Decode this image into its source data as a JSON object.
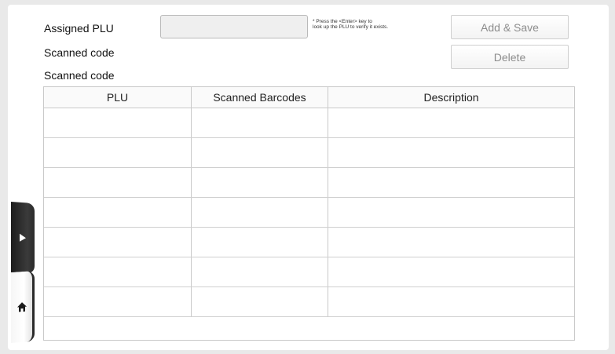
{
  "form": {
    "assigned_plu_label": "Assigned PLU",
    "assigned_plu_value": "",
    "scanned_code_label_1": "Scanned code",
    "scanned_code_label_2": "Scanned code",
    "hint_line1": "* Press the <Enter> key to",
    "hint_line2": "look up the PLU to verify it exists."
  },
  "buttons": {
    "add_save": "Add & Save",
    "delete": "Delete"
  },
  "table": {
    "headers": [
      "PLU",
      "Scanned Barcodes",
      "Description"
    ],
    "rows": [
      [
        "",
        "",
        ""
      ],
      [
        "",
        "",
        ""
      ],
      [
        "",
        "",
        ""
      ],
      [
        "",
        "",
        ""
      ],
      [
        "",
        "",
        ""
      ],
      [
        "",
        "",
        ""
      ],
      [
        "",
        "",
        ""
      ]
    ]
  },
  "side_nav": {
    "expand_icon": "play-right-icon",
    "home_icon": "home-icon"
  }
}
